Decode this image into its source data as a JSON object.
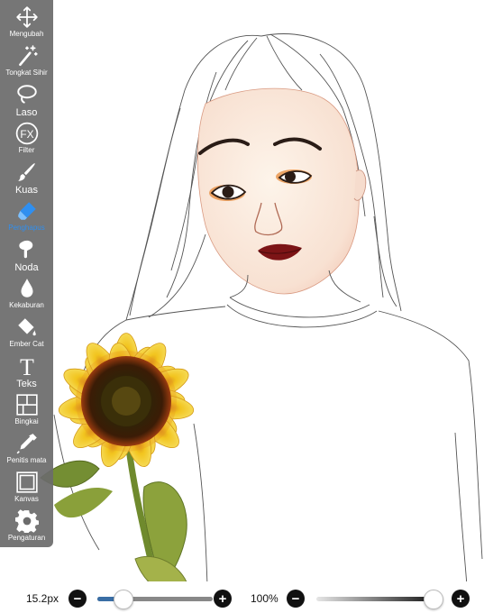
{
  "toolbar": {
    "items": [
      {
        "label": "Mengubah",
        "icon": "move-icon"
      },
      {
        "label": "Tongkat Sihir",
        "icon": "magic-wand-icon"
      },
      {
        "label": "Laso",
        "icon": "lasso-icon"
      },
      {
        "label": "Filter",
        "icon": "fx-filter-icon"
      },
      {
        "label": "Kuas",
        "icon": "brush-icon"
      },
      {
        "label": "Penghapus",
        "icon": "eraser-icon"
      },
      {
        "label": "Noda",
        "icon": "smudge-icon"
      },
      {
        "label": "Kekaburan",
        "icon": "blur-drop-icon"
      },
      {
        "label": "Ember Cat",
        "icon": "paint-bucket-icon"
      },
      {
        "label": "Teks",
        "icon": "text-icon"
      },
      {
        "label": "Bingkai",
        "icon": "frame-icon"
      },
      {
        "label": "Penitis mata",
        "icon": "eyedropper-icon"
      },
      {
        "label": "Kanvas",
        "icon": "canvas-icon"
      },
      {
        "label": "Pengaturan",
        "icon": "settings-gear-icon"
      }
    ],
    "active": "Penghapus",
    "fx_glyph": "FX",
    "text_glyph": "T"
  },
  "bottom": {
    "brush_size": "15.2px",
    "brush_size_fraction": 0.22,
    "opacity": "100%",
    "opacity_fraction": 1.0,
    "minus": "−",
    "plus": "+"
  },
  "colors": {
    "toolbar_bg": "#6c6c6c",
    "active": "#2f8ff0",
    "slider_fill": "#3a6ea5"
  }
}
